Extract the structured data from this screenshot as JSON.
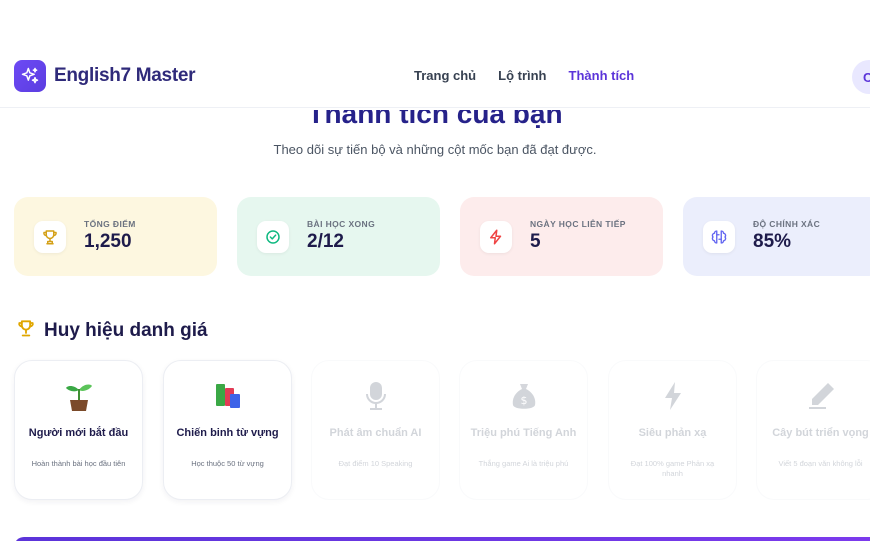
{
  "brand": {
    "name": "English7 Master"
  },
  "nav": {
    "links": [
      "Trang chủ",
      "Lộ trình",
      "Thành tích"
    ],
    "active": "Thành tích",
    "avatar_initial": "C"
  },
  "header": {
    "title": "Thành tích của bạn",
    "subtitle": "Theo dõi sự tiến bộ và những cột mốc bạn đã đạt được."
  },
  "stats": [
    {
      "label": "TỔNG ĐIỂM",
      "value": "1,250",
      "icon": "trophy-icon",
      "color": "#d4a017"
    },
    {
      "label": "BÀI HỌC XONG",
      "value": "2/12",
      "icon": "check-circle-icon",
      "color": "#10b981"
    },
    {
      "label": "NGÀY HỌC LIÊN TIẾP",
      "value": "5",
      "icon": "lightning-icon",
      "color": "#ef4444"
    },
    {
      "label": "ĐỘ CHÍNH XÁC",
      "value": "85%",
      "icon": "brain-icon",
      "color": "#6366f1"
    }
  ],
  "badges_section": {
    "title": "Huy hiệu danh giá",
    "icon": "trophy-icon"
  },
  "badges": [
    {
      "title": "Người mới bắt đầu",
      "desc": "Hoàn thành bài học đầu tiên",
      "icon": "seedling-icon",
      "unlocked": true
    },
    {
      "title": "Chiến binh từ vựng",
      "desc": "Học thuộc 50 từ vựng",
      "icon": "books-icon",
      "unlocked": true
    },
    {
      "title": "Phát âm chuẩn AI",
      "desc": "Đạt điểm 10 Speaking",
      "icon": "microphone-icon",
      "unlocked": false
    },
    {
      "title": "Triệu phú Tiếng Anh",
      "desc": "Thắng game Ai là triệu phú",
      "icon": "money-bag-icon",
      "unlocked": false
    },
    {
      "title": "Siêu phản xạ",
      "desc": "Đạt 100% game Phản xạ nhanh",
      "icon": "lightning-icon",
      "unlocked": false
    },
    {
      "title": "Cây bút triển vọng",
      "desc": "Viết 5 đoạn văn không lỗi",
      "icon": "pen-icon",
      "unlocked": false
    }
  ]
}
